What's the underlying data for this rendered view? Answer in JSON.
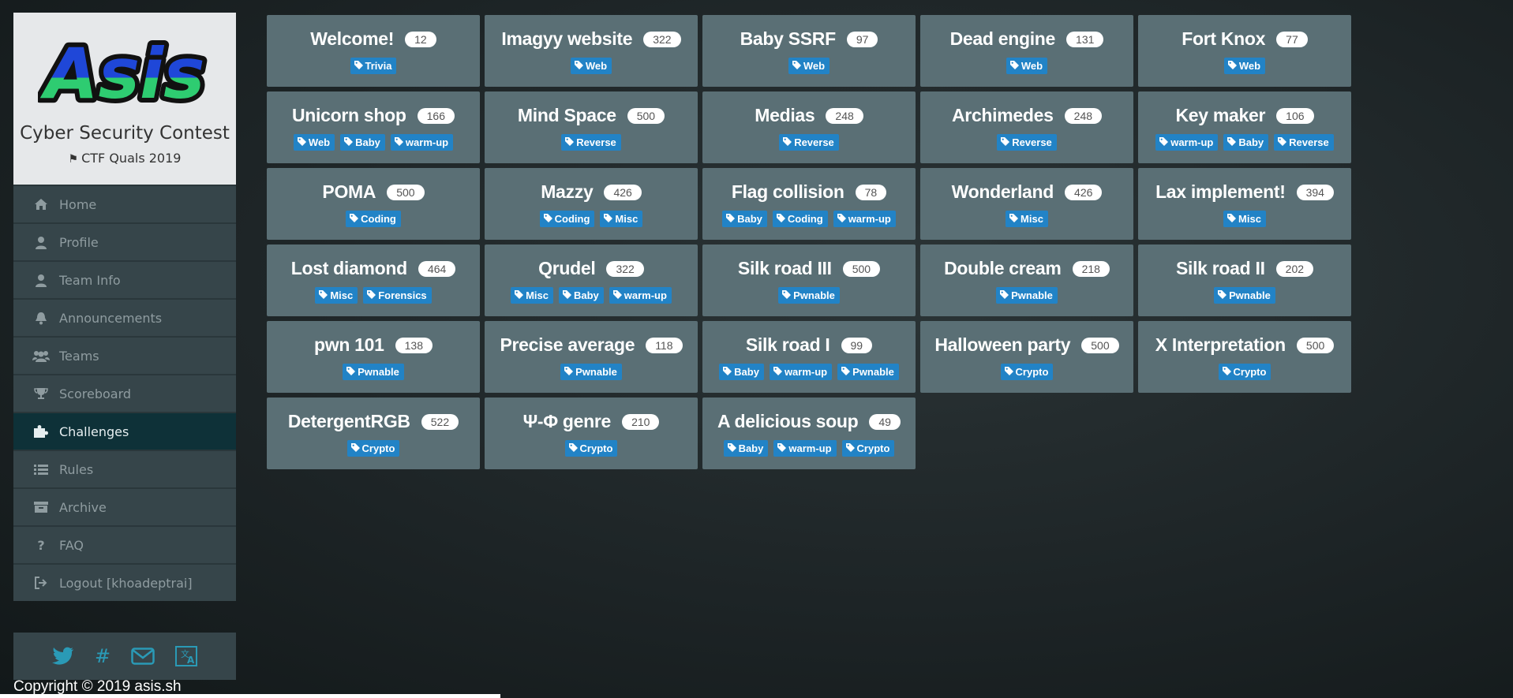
{
  "brand": {
    "logo_text": "Asis",
    "title": "Cyber Security Contest",
    "subtitle": "CTF Quals 2019"
  },
  "nav": [
    {
      "label": "Home",
      "icon": "home-icon",
      "active": false
    },
    {
      "label": "Profile",
      "icon": "user-icon",
      "active": false
    },
    {
      "label": "Team Info",
      "icon": "user-icon",
      "active": false
    },
    {
      "label": "Announcements",
      "icon": "bell-icon",
      "active": false
    },
    {
      "label": "Teams",
      "icon": "users-icon",
      "active": false
    },
    {
      "label": "Scoreboard",
      "icon": "trophy-icon",
      "active": false
    },
    {
      "label": "Challenges",
      "icon": "puzzle-icon",
      "active": true
    },
    {
      "label": "Rules",
      "icon": "list-icon",
      "active": false
    },
    {
      "label": "Archive",
      "icon": "archive-icon",
      "active": false
    },
    {
      "label": "FAQ",
      "icon": "question-icon",
      "active": false
    },
    {
      "label": "Logout [khoadeptrai]",
      "icon": "logout-icon",
      "active": false
    }
  ],
  "social": [
    "twitter-icon",
    "hash-icon",
    "envelope-icon",
    "translate-icon"
  ],
  "copyright": "Copyright © 2019 asis.sh",
  "colors": {
    "card": "#5a6f75",
    "tag": "#2283c6",
    "active_nav": "#0e3138",
    "social": "#2a9ab6"
  },
  "challenges": [
    {
      "name": "Welcome!",
      "points": "12",
      "tags": [
        "Trivia"
      ]
    },
    {
      "name": "Imagyy website",
      "points": "322",
      "tags": [
        "Web"
      ]
    },
    {
      "name": "Baby SSRF",
      "points": "97",
      "tags": [
        "Web"
      ]
    },
    {
      "name": "Dead engine",
      "points": "131",
      "tags": [
        "Web"
      ]
    },
    {
      "name": "Fort Knox",
      "points": "77",
      "tags": [
        "Web"
      ]
    },
    {
      "name": "Unicorn shop",
      "points": "166",
      "tags": [
        "Web",
        "Baby",
        "warm-up"
      ]
    },
    {
      "name": "Mind Space",
      "points": "500",
      "tags": [
        "Reverse"
      ]
    },
    {
      "name": "Medias",
      "points": "248",
      "tags": [
        "Reverse"
      ]
    },
    {
      "name": "Archimedes",
      "points": "248",
      "tags": [
        "Reverse"
      ]
    },
    {
      "name": "Key maker",
      "points": "106",
      "tags": [
        "warm-up",
        "Baby",
        "Reverse"
      ]
    },
    {
      "name": "POMA",
      "points": "500",
      "tags": [
        "Coding"
      ]
    },
    {
      "name": "Mazzy",
      "points": "426",
      "tags": [
        "Coding",
        "Misc"
      ]
    },
    {
      "name": "Flag collision",
      "points": "78",
      "tags": [
        "Baby",
        "Coding",
        "warm-up"
      ]
    },
    {
      "name": "Wonderland",
      "points": "426",
      "tags": [
        "Misc"
      ]
    },
    {
      "name": "Lax implement!",
      "points": "394",
      "tags": [
        "Misc"
      ]
    },
    {
      "name": "Lost diamond",
      "points": "464",
      "tags": [
        "Misc",
        "Forensics"
      ]
    },
    {
      "name": "Qrudel",
      "points": "322",
      "tags": [
        "Misc",
        "Baby",
        "warm-up"
      ]
    },
    {
      "name": "Silk road III",
      "points": "500",
      "tags": [
        "Pwnable"
      ]
    },
    {
      "name": "Double cream",
      "points": "218",
      "tags": [
        "Pwnable"
      ]
    },
    {
      "name": "Silk road II",
      "points": "202",
      "tags": [
        "Pwnable"
      ]
    },
    {
      "name": "pwn 101",
      "points": "138",
      "tags": [
        "Pwnable"
      ]
    },
    {
      "name": "Precise average",
      "points": "118",
      "tags": [
        "Pwnable"
      ]
    },
    {
      "name": "Silk road I",
      "points": "99",
      "tags": [
        "Baby",
        "warm-up",
        "Pwnable"
      ]
    },
    {
      "name": "Halloween party",
      "points": "500",
      "tags": [
        "Crypto"
      ]
    },
    {
      "name": "X Interpretation",
      "points": "500",
      "tags": [
        "Crypto"
      ]
    },
    {
      "name": "DetergentRGB",
      "points": "522",
      "tags": [
        "Crypto"
      ]
    },
    {
      "name": "Ψ-Φ genre",
      "points": "210",
      "tags": [
        "Crypto"
      ]
    },
    {
      "name": "A delicious soup",
      "points": "49",
      "tags": [
        "Baby",
        "warm-up",
        "Crypto"
      ]
    }
  ]
}
